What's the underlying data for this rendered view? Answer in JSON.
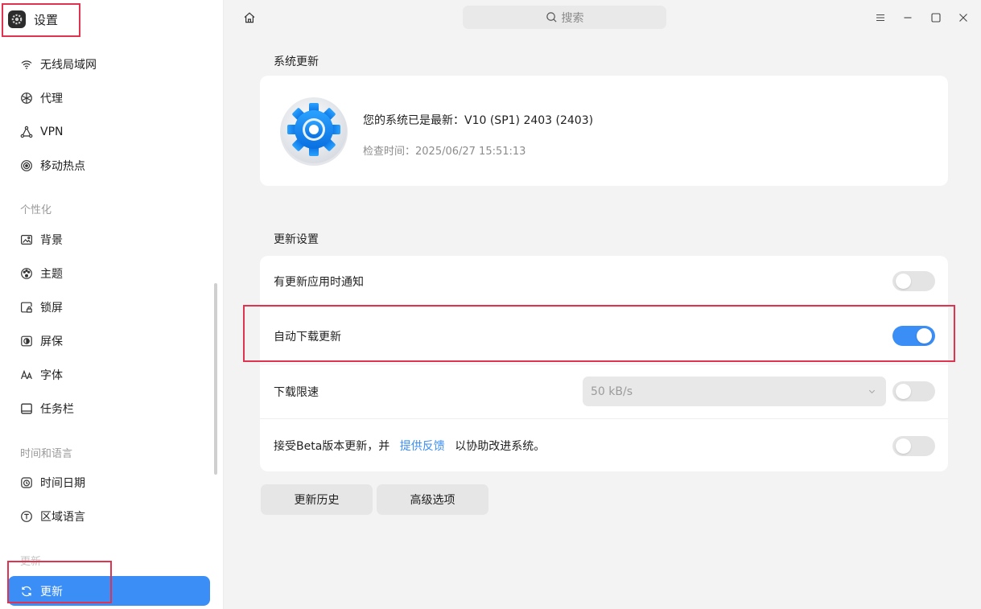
{
  "app": {
    "title": "设置"
  },
  "search": {
    "placeholder": "搜索"
  },
  "sidebar": {
    "network_items": [
      {
        "label": "无线局域网",
        "icon": "wifi-icon"
      },
      {
        "label": "代理",
        "icon": "proxy-icon"
      },
      {
        "label": "VPN",
        "icon": "vpn-icon"
      },
      {
        "label": "移动热点",
        "icon": "hotspot-icon"
      }
    ],
    "personalization_header": "个性化",
    "personalization_items": [
      {
        "label": "背景",
        "icon": "wallpaper-icon"
      },
      {
        "label": "主题",
        "icon": "palette-icon"
      },
      {
        "label": "锁屏",
        "icon": "lockscreen-icon"
      },
      {
        "label": "屏保",
        "icon": "screensaver-icon"
      },
      {
        "label": "字体",
        "icon": "font-icon"
      },
      {
        "label": "任务栏",
        "icon": "taskbar-icon"
      }
    ],
    "time_header": "时间和语言",
    "time_items": [
      {
        "label": "时间日期",
        "icon": "clock-icon"
      },
      {
        "label": "区域语言",
        "icon": "language-icon"
      }
    ],
    "update_header": "更新",
    "update_items": [
      {
        "label": "更新",
        "icon": "refresh-icon",
        "active": true
      }
    ]
  },
  "main": {
    "system_update": {
      "title": "系统更新",
      "status": "您的系统已是最新：V10 (SP1) 2403 (2403)",
      "check_time": "检查时间：2025/06/27 15:51:13"
    },
    "update_settings": {
      "title": "更新设置",
      "notify_label": "有更新应用时通知",
      "notify_enabled": false,
      "auto_download_label": "自动下载更新",
      "auto_download_enabled": true,
      "speed_limit_label": "下载限速",
      "speed_limit_value": "50 kB/s",
      "speed_limit_enabled": false,
      "beta_prefix": "接受Beta版本更新，并",
      "beta_link": "提供反馈",
      "beta_suffix": "以协助改进系统。",
      "beta_enabled": false
    },
    "buttons": {
      "history": "更新历史",
      "advanced": "高级选项"
    }
  },
  "colors": {
    "accent": "#3b8ef5",
    "highlight_box": "#e0334f"
  }
}
